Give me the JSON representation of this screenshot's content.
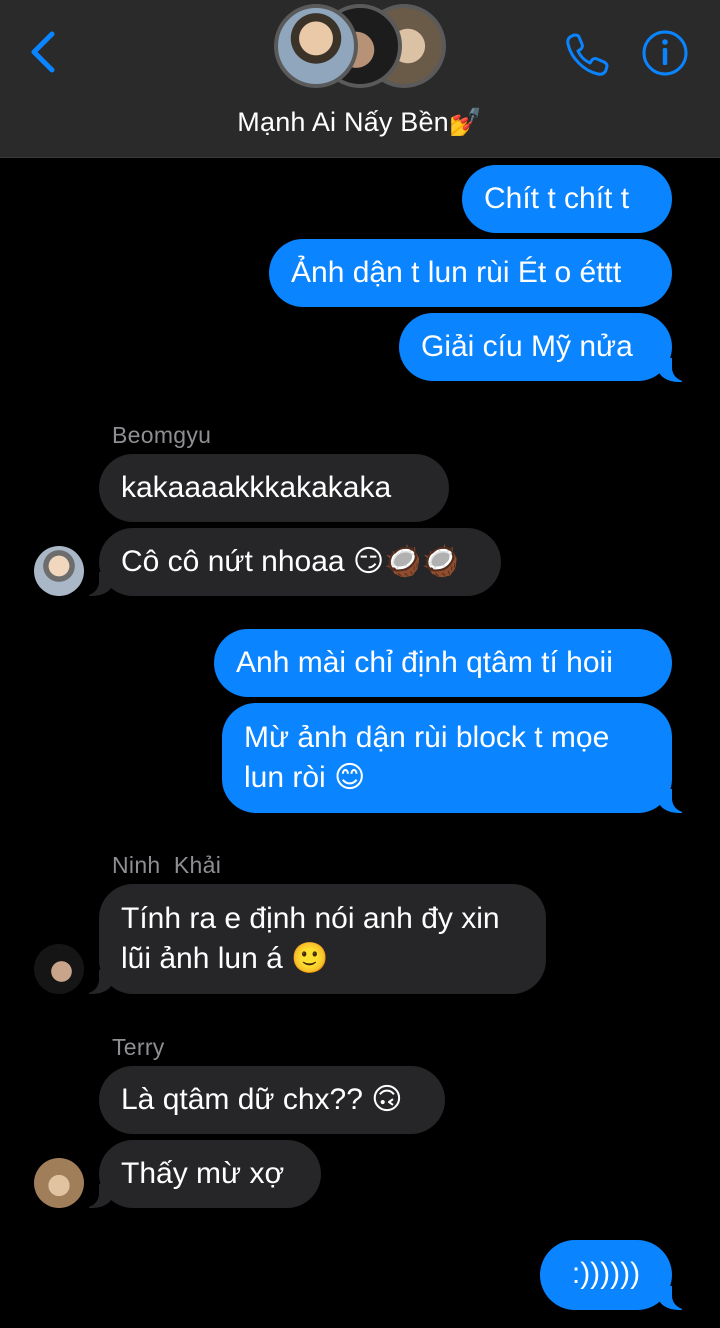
{
  "header": {
    "back_icon": "chevron-left-icon",
    "title": "Mạnh Ai Nấy Bền💅",
    "call_icon": "phone-icon",
    "info_icon": "info-icon",
    "accent": "#0a84ff"
  },
  "messages": [
    {
      "direction": "out",
      "text": "Chít t chít t"
    },
    {
      "direction": "out",
      "text": "Ảnh dận t lun rùi Ét o éttt"
    },
    {
      "direction": "out",
      "text": "Giải cíu Mỹ nửa"
    },
    {
      "direction": "in",
      "sender": "Beomgyu",
      "text": "kakaaaakkkakakaka"
    },
    {
      "direction": "in",
      "sender": "Beomgyu",
      "text": "Cô cô nứt nhoaa 😏🥥🥥"
    },
    {
      "direction": "out",
      "text": "Anh mài chỉ định qtâm tí hoii"
    },
    {
      "direction": "out",
      "text": "Mừ ảnh dận rùi block t mọe lun ròi 😊"
    },
    {
      "direction": "in",
      "sender": "Ninh  Khải",
      "text": "Tính ra e định nói anh đy xin lũi ảnh lun á 🙂"
    },
    {
      "direction": "in",
      "sender": "Terry",
      "text": "Là qtâm dữ chx?? 🙃"
    },
    {
      "direction": "in",
      "sender": "Terry",
      "text": "Thấy mừ xợ"
    },
    {
      "direction": "out",
      "text": ":))))))"
    }
  ],
  "colors": {
    "outgoing_bubble": "#0a84ff",
    "incoming_bubble": "#262628",
    "background": "#000000",
    "sender_name": "#8e8e93"
  }
}
